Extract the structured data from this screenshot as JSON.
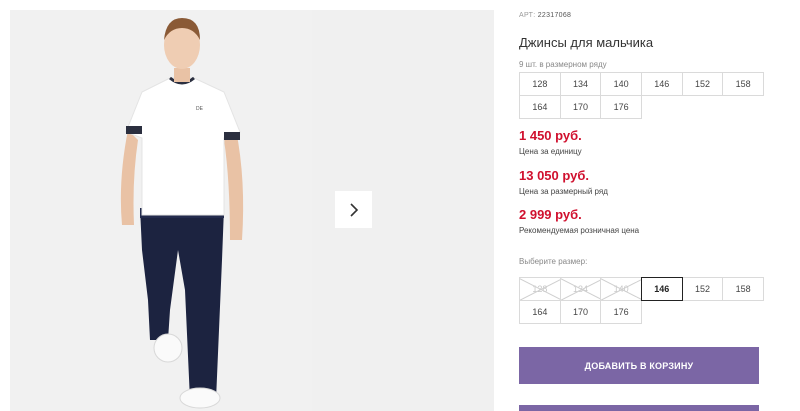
{
  "product": {
    "article_label": "АРТ:",
    "article_number": "22317068",
    "title": "Джинсы для мальчика",
    "pack_hint": "9 шт. в размерном ряду",
    "pack_sizes": [
      "128",
      "134",
      "140",
      "146",
      "152",
      "158",
      "164",
      "170",
      "176"
    ],
    "unit_price": "1 450 руб.",
    "unit_price_label": "Цена за единицу",
    "pack_price": "13 050 руб.",
    "pack_price_label": "Цена за размерный ряд",
    "retail_price": "2 999 руб.",
    "retail_price_label": "Рекомендуемая розничная цена",
    "choose_size_label": "Выберите размер:",
    "size_options": [
      {
        "label": "128",
        "state": "disabled"
      },
      {
        "label": "134",
        "state": "disabled"
      },
      {
        "label": "140",
        "state": "disabled"
      },
      {
        "label": "146",
        "state": "selected"
      },
      {
        "label": "152",
        "state": "available"
      },
      {
        "label": "158",
        "state": "available"
      },
      {
        "label": "164",
        "state": "available"
      },
      {
        "label": "170",
        "state": "available"
      },
      {
        "label": "176",
        "state": "available"
      }
    ],
    "add_to_cart_label": "ДОБАВИТЬ В КОРЗИНУ",
    "tshirt_logo": "DE"
  },
  "colors": {
    "price": "#d0102e",
    "button": "#7b66a5",
    "jeans": "#1c2340",
    "shirt": "#ffffff",
    "gallery_bg": "#f1f1f1"
  },
  "icons": {
    "next": "chevron-right-icon"
  }
}
